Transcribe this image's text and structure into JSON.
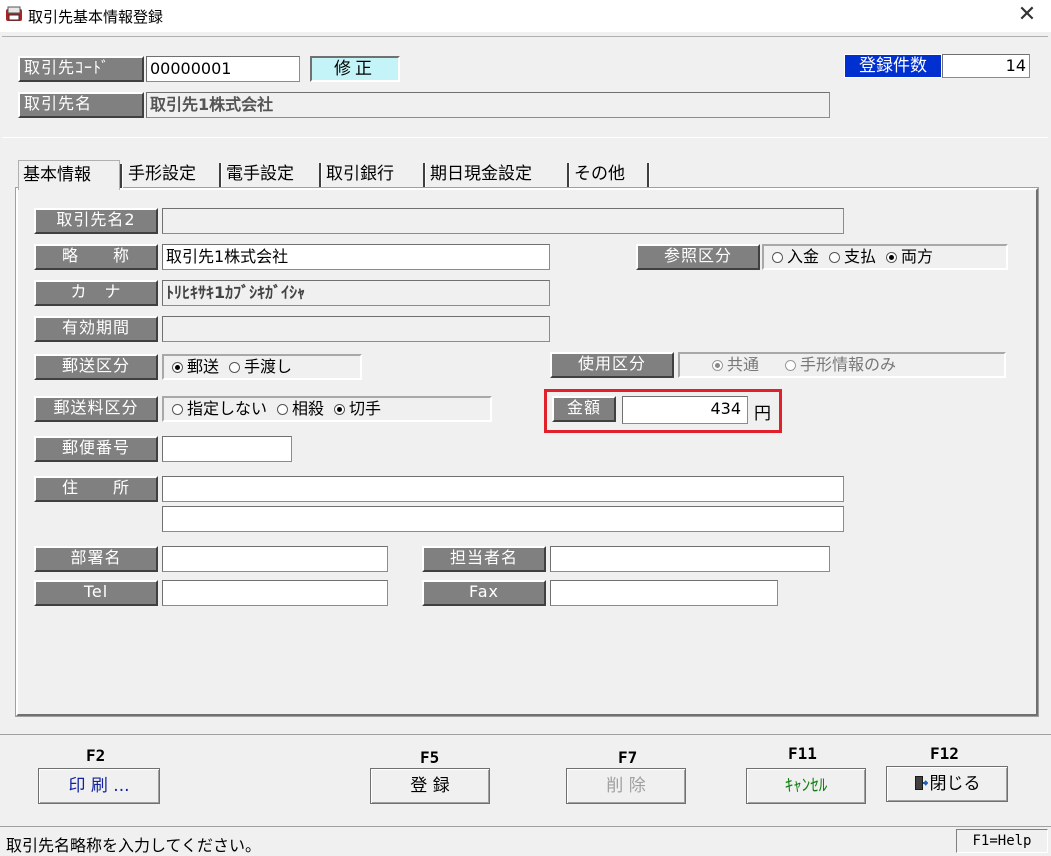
{
  "window": {
    "title": "取引先基本情報登録",
    "close_icon": "close-icon"
  },
  "header": {
    "code_label": "取引先ｺｰﾄﾞ",
    "code_value": "00000001",
    "mode": "修正",
    "name_label": "取引先名",
    "name_value": "取引先1株式会社",
    "count_label": "登録件数",
    "count_value": "14"
  },
  "tabs": [
    {
      "label": "基本情報",
      "active": true
    },
    {
      "label": "手形設定"
    },
    {
      "label": "電手設定"
    },
    {
      "label": "取引銀行"
    },
    {
      "label": "期日現金設定"
    },
    {
      "label": "その他"
    }
  ],
  "form": {
    "name2_label": "取引先名2",
    "name2_value": "",
    "short_label": "略　　称",
    "short_value": "取引先1株式会社",
    "kana_label": "カ　ナ",
    "kana_value": "ﾄﾘﾋｷｻｷ1ｶﾌﾞｼｷｶﾞｲｼｬ",
    "valid_label": "有効期間",
    "valid_value": "",
    "ref_label": "参照区分",
    "ref_options": [
      "入金",
      "支払",
      "両方"
    ],
    "ref_selected": "両方",
    "mail_label": "郵送区分",
    "mail_options": [
      "郵送",
      "手渡し"
    ],
    "mail_selected": "郵送",
    "usage_label": "使用区分",
    "usage_options": [
      "共通",
      "手形情報のみ"
    ],
    "usage_selected": "共通",
    "postage_label": "郵送料区分",
    "postage_options": [
      "指定しない",
      "相殺",
      "切手"
    ],
    "postage_selected": "切手",
    "amount_label": "金額",
    "amount_value": "434",
    "amount_unit": "円",
    "zip_label": "郵便番号",
    "zip_value": "",
    "address_label": "住　　所",
    "address1": "",
    "address2": "",
    "dept_label": "部署名",
    "dept_value": "",
    "person_label": "担当者名",
    "person_value": "",
    "tel_label": "Tel",
    "tel_value": "",
    "fax_label": "Fax",
    "fax_value": ""
  },
  "fkeys": [
    {
      "key": "F2",
      "label": "印 刷 ..."
    },
    {
      "key": "F5",
      "label": "登 録"
    },
    {
      "key": "F7",
      "label": "削 除"
    },
    {
      "key": "F11",
      "label": "ｷｬﾝｾﾙ"
    },
    {
      "key": "F12",
      "label": "閉じる"
    }
  ],
  "status": {
    "message": "取引先名略称を入力してください。",
    "help": "F1=Help"
  }
}
